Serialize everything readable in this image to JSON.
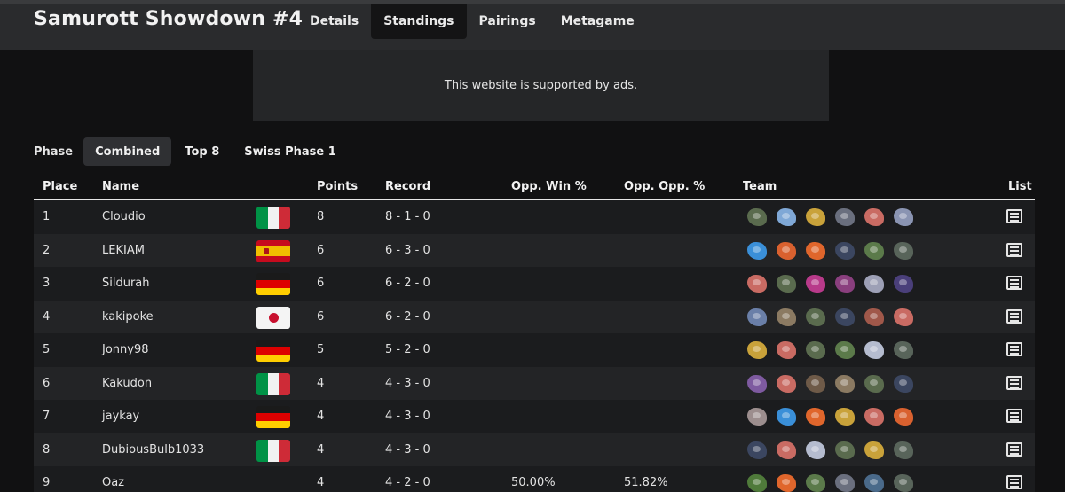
{
  "site_title": "Samurott Showdown #4",
  "nav": [
    "Details",
    "Standings",
    "Pairings",
    "Metagame"
  ],
  "ad_text": "This website is supported by ads.",
  "phases": {
    "label": "Phase",
    "items": [
      "Combined",
      "Top 8",
      "Swiss Phase 1"
    ]
  },
  "columns": {
    "place": "Place",
    "name": "Name",
    "points": "Points",
    "record": "Record",
    "opp_win": "Opp. Win %",
    "opp_opp": "Opp. Opp. %",
    "team": "Team",
    "list": "List"
  },
  "rows": [
    {
      "place": "1",
      "name": "Cloudio",
      "flag": "italy",
      "points": "8",
      "record": "8 - 1 - 0",
      "opp_win": "",
      "opp_opp": ""
    },
    {
      "place": "2",
      "name": "LEKIAM",
      "flag": "spain",
      "points": "6",
      "record": "6 - 3 - 0",
      "opp_win": "",
      "opp_opp": ""
    },
    {
      "place": "3",
      "name": "Sildurah",
      "flag": "germany",
      "points": "6",
      "record": "6 - 2 - 0",
      "opp_win": "",
      "opp_opp": ""
    },
    {
      "place": "4",
      "name": "kakipoke",
      "flag": "japan",
      "points": "6",
      "record": "6 - 2 - 0",
      "opp_win": "",
      "opp_opp": ""
    },
    {
      "place": "5",
      "name": "Jonny98",
      "flag": "germany",
      "points": "5",
      "record": "5 - 2 - 0",
      "opp_win": "",
      "opp_opp": ""
    },
    {
      "place": "6",
      "name": "Kakudon",
      "flag": "italy",
      "points": "4",
      "record": "4 - 3 - 0",
      "opp_win": "",
      "opp_opp": ""
    },
    {
      "place": "7",
      "name": "jaykay",
      "flag": "germany",
      "points": "4",
      "record": "4 - 3 - 0",
      "opp_win": "",
      "opp_opp": ""
    },
    {
      "place": "8",
      "name": "DubiousBulb1033",
      "flag": "italy",
      "points": "4",
      "record": "4 - 3 - 0",
      "opp_win": "",
      "opp_opp": ""
    },
    {
      "place": "9",
      "name": "Oaz",
      "flag": "",
      "points": "4",
      "record": "4 - 2 - 0",
      "opp_win": "50.00%",
      "opp_opp": "51.82%"
    }
  ],
  "colors": {
    "header_bg": "#2a2b2d",
    "page_bg": "#111112",
    "row_odd": "#1b1c1e",
    "row_even": "#232426"
  },
  "team_sprite_colors": [
    [
      "#5a6b4e",
      "#7fa8d6",
      "#c9a23a",
      "#6a6f7e",
      "#c96b63",
      "#8a94b2"
    ],
    [
      "#3a8fd8",
      "#d9612f",
      "#e0662c",
      "#3b4660",
      "#5b7a4a",
      "#58645a"
    ],
    [
      "#c96b63",
      "#5a6b4e",
      "#b83a8a",
      "#8a3f7e",
      "#9da0b6",
      "#4a3f7a"
    ],
    [
      "#6a7fa8",
      "#8b7a62",
      "#5a6b4e",
      "#3b4660",
      "#a0584a",
      "#c96b63"
    ],
    [
      "#c9a23a",
      "#c96b63",
      "#5a6b4e",
      "#5b7a4a",
      "#b5bccf",
      "#58645a"
    ],
    [
      "#7e5aa0",
      "#c96b63",
      "#6e5a48",
      "#8b7a62",
      "#5a6b4e",
      "#3b4660"
    ],
    [
      "#9c8e8e",
      "#3a8fd8",
      "#e0662c",
      "#c9a23a",
      "#c96b63",
      "#d9612f"
    ],
    [
      "#3b4660",
      "#c96b63",
      "#b5bccf",
      "#5a6b4e",
      "#c9a23a",
      "#58645a"
    ],
    [
      "#4f7a3a",
      "#e0662c",
      "#5b7a4a",
      "#6a6f7e",
      "#4a6a8a",
      "#58645a"
    ]
  ]
}
